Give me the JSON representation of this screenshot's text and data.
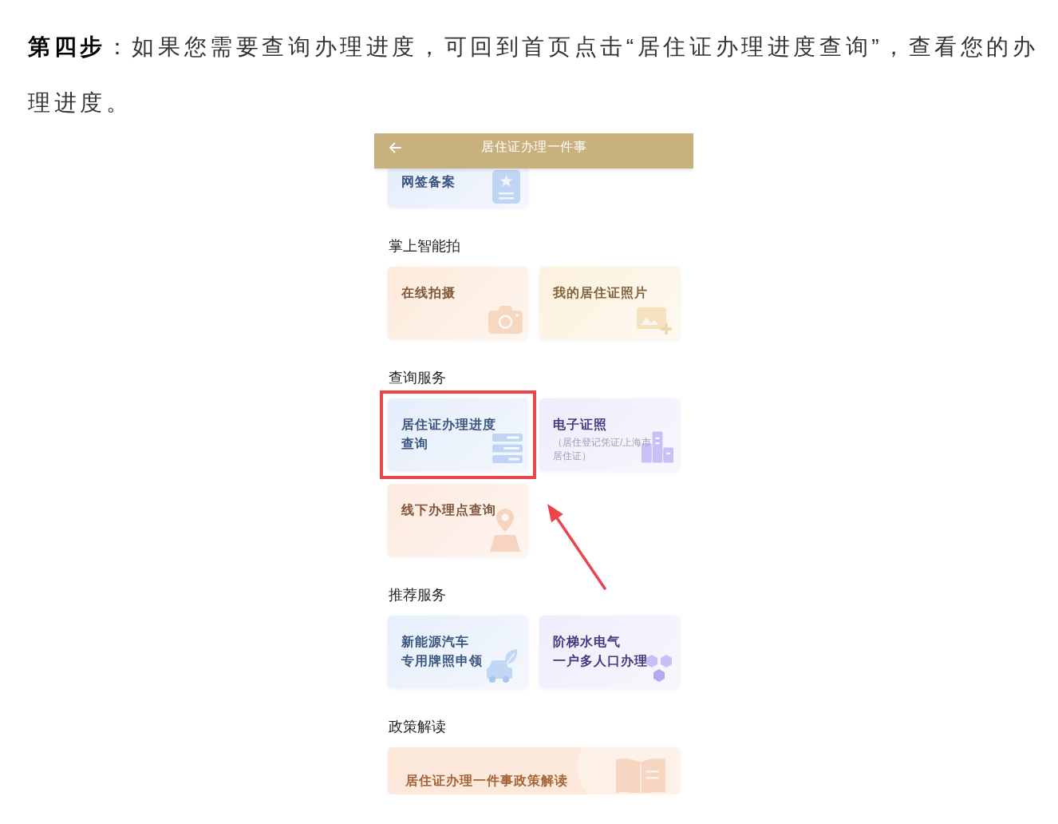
{
  "article": {
    "paragraph": "**第四步**：如果您需要查询办理进度，可回到首页点击“居住证办理进度查询”，查看您的办理进度。"
  },
  "phone": {
    "header": {
      "title": "居住证办理一件事"
    },
    "sections": [
      {
        "cards": [
          {
            "kind": "tile",
            "title_lines": [
              "网签备案"
            ],
            "color": "#e6eefc",
            "highlighted": false
          }
        ]
      },
      {
        "title": "掌上智能拍",
        "cards": [
          {
            "kind": "tile",
            "title_lines": [
              "在线拍摄"
            ],
            "color": "#fdeadb",
            "highlighted": false
          },
          {
            "kind": "tile",
            "title_lines": [
              "我的居住证照片"
            ],
            "color": "#fdf1de",
            "highlighted": false
          }
        ]
      },
      {
        "title": "查询服务",
        "cards": [
          {
            "kind": "tile",
            "title_lines": [
              "居住证办理进度查询"
            ],
            "color": "#e5eefc",
            "highlighted": true
          },
          {
            "kind": "tile",
            "title_lines": [
              "电子证照"
            ],
            "note": "（居住登记凭证/上海市居住证）",
            "color": "#efecfc",
            "highlighted": false
          },
          {
            "kind": "tile",
            "title_lines": [
              "线下办理点查询"
            ],
            "color": "#fdeadf",
            "highlighted": false
          }
        ]
      },
      {
        "title": "推荐服务",
        "cards": [
          {
            "kind": "tile",
            "title_lines": [
              "新能源汽车",
              "专用牌照申领"
            ],
            "color": "#e6effc",
            "highlighted": false
          },
          {
            "kind": "tile",
            "title_lines": [
              "阶梯水电气",
              "一户多人口办理"
            ],
            "color": "#efedfc",
            "highlighted": false
          }
        ]
      },
      {
        "title": "政策解读",
        "cards": [
          {
            "kind": "banner",
            "title_lines": [
              "居住证办理一件事政策解读"
            ],
            "color": "#fde9dc",
            "highlighted": false
          }
        ]
      }
    ]
  }
}
